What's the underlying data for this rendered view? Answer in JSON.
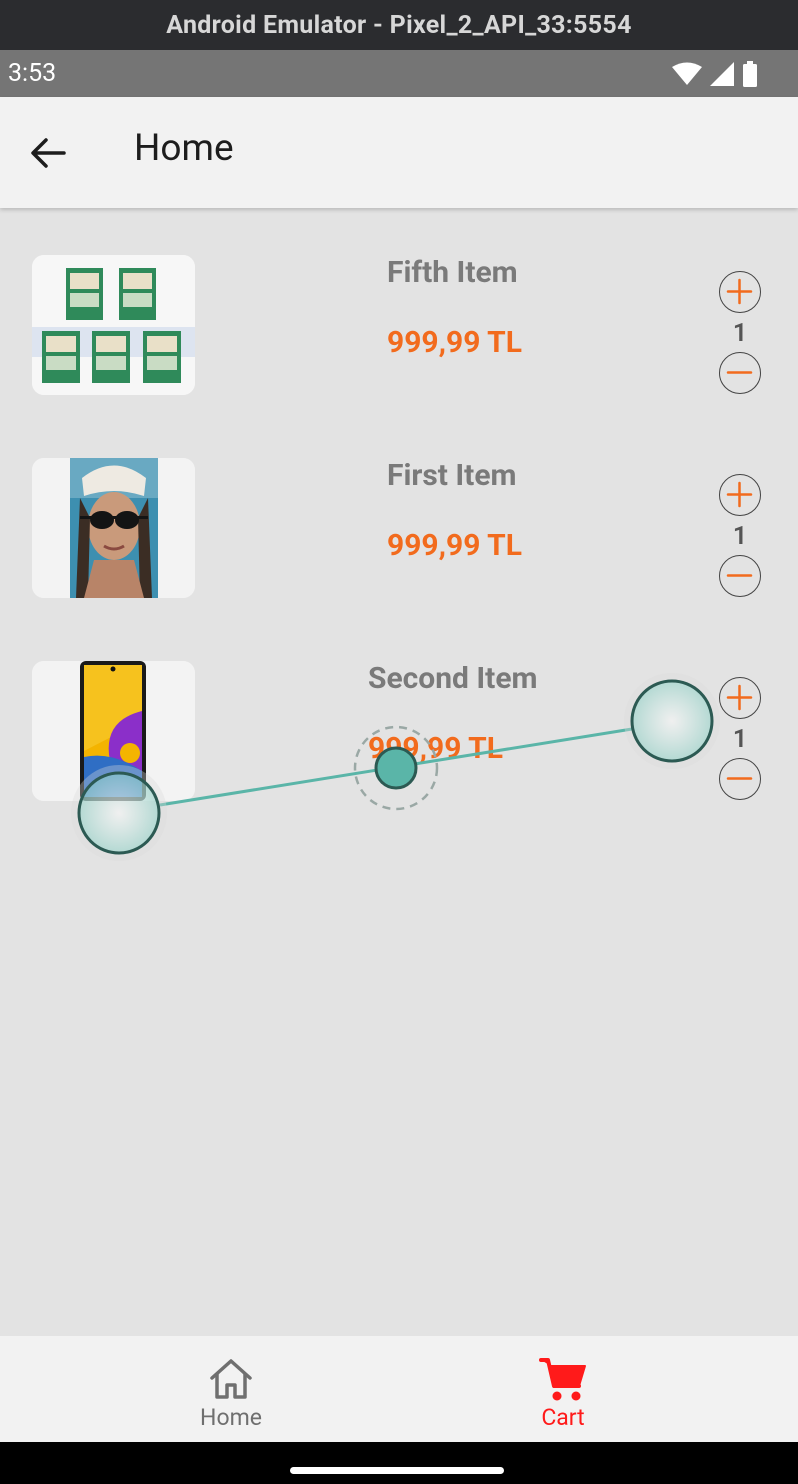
{
  "emulator": {
    "title": "Android Emulator - Pixel_2_API_33:5554"
  },
  "status_bar": {
    "time": "3:53",
    "icons": [
      "wifi-icon",
      "signal-icon",
      "battery-icon"
    ]
  },
  "app_bar": {
    "title": "Home",
    "back_icon": "arrow-left-icon"
  },
  "cart_items": [
    {
      "name": "Fifth Item",
      "price": "999,99 TL",
      "quantity": "1",
      "image": "packaged-product-grid"
    },
    {
      "name": "First Item",
      "price": "999,99 TL",
      "quantity": "1",
      "image": "woman-sunglasses-photo"
    },
    {
      "name": "Second Item",
      "price": "999,99 TL",
      "quantity": "1",
      "image": "smartphone-photo"
    }
  ],
  "bottom_nav": {
    "items": [
      {
        "label": "Home",
        "icon": "home-icon",
        "active": false
      },
      {
        "label": "Cart",
        "icon": "cart-icon",
        "active": true
      }
    ]
  },
  "colors": {
    "price": "#f26b1d",
    "active_nav": "#ff1a1a",
    "inactive_nav": "#6f6f6f",
    "touch_indicator": "#5ab5a8"
  }
}
